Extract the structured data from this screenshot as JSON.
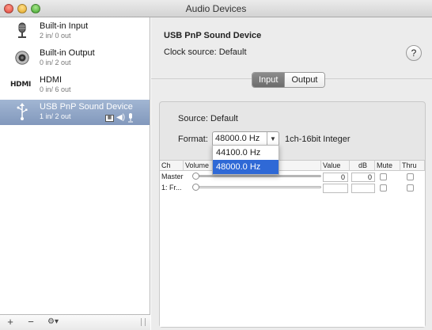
{
  "window": {
    "title": "Audio Devices"
  },
  "sidebar": {
    "devices": [
      {
        "name": "Built-in Input",
        "io": "2 in/ 0 out",
        "icon": "microphone-icon"
      },
      {
        "name": "Built-in Output",
        "io": "0 in/ 2 out",
        "icon": "speaker-icon"
      },
      {
        "name": "HDMI",
        "io": "0 in/ 6 out",
        "icon": "hdmi-icon",
        "icon_text": "HDMI"
      },
      {
        "name": "USB PnP Sound Device",
        "io": "1 in/ 2 out",
        "icon": "usb-icon",
        "selected": true
      }
    ],
    "footer": {
      "add": "+",
      "remove": "−",
      "gear": "⚙▾"
    }
  },
  "main": {
    "device_title": "USB PnP Sound Device",
    "clock_source": "Clock source: Default",
    "help": "?",
    "tabs": [
      {
        "label": "Input",
        "active": true
      },
      {
        "label": "Output",
        "active": false
      }
    ],
    "source": "Source: Default",
    "format_label": "Format:",
    "format_value": "48000.0 Hz",
    "format_bits": "1ch-16bit Integer",
    "format_options": [
      "44100.0 Hz",
      "48000.0 Hz"
    ],
    "format_selected": "48000.0 Hz",
    "table": {
      "columns": [
        "Ch",
        "Volume",
        "Value",
        "dB",
        "Mute",
        "Thru"
      ],
      "rows": [
        {
          "ch": "Master",
          "value": "0",
          "db": "0"
        },
        {
          "ch": "1: Fr...",
          "value": "",
          "db": ""
        }
      ]
    }
  },
  "colors": {
    "selection": "#8298bc",
    "highlight": "#2f69d6",
    "active_tab": "#7a7a7a"
  }
}
